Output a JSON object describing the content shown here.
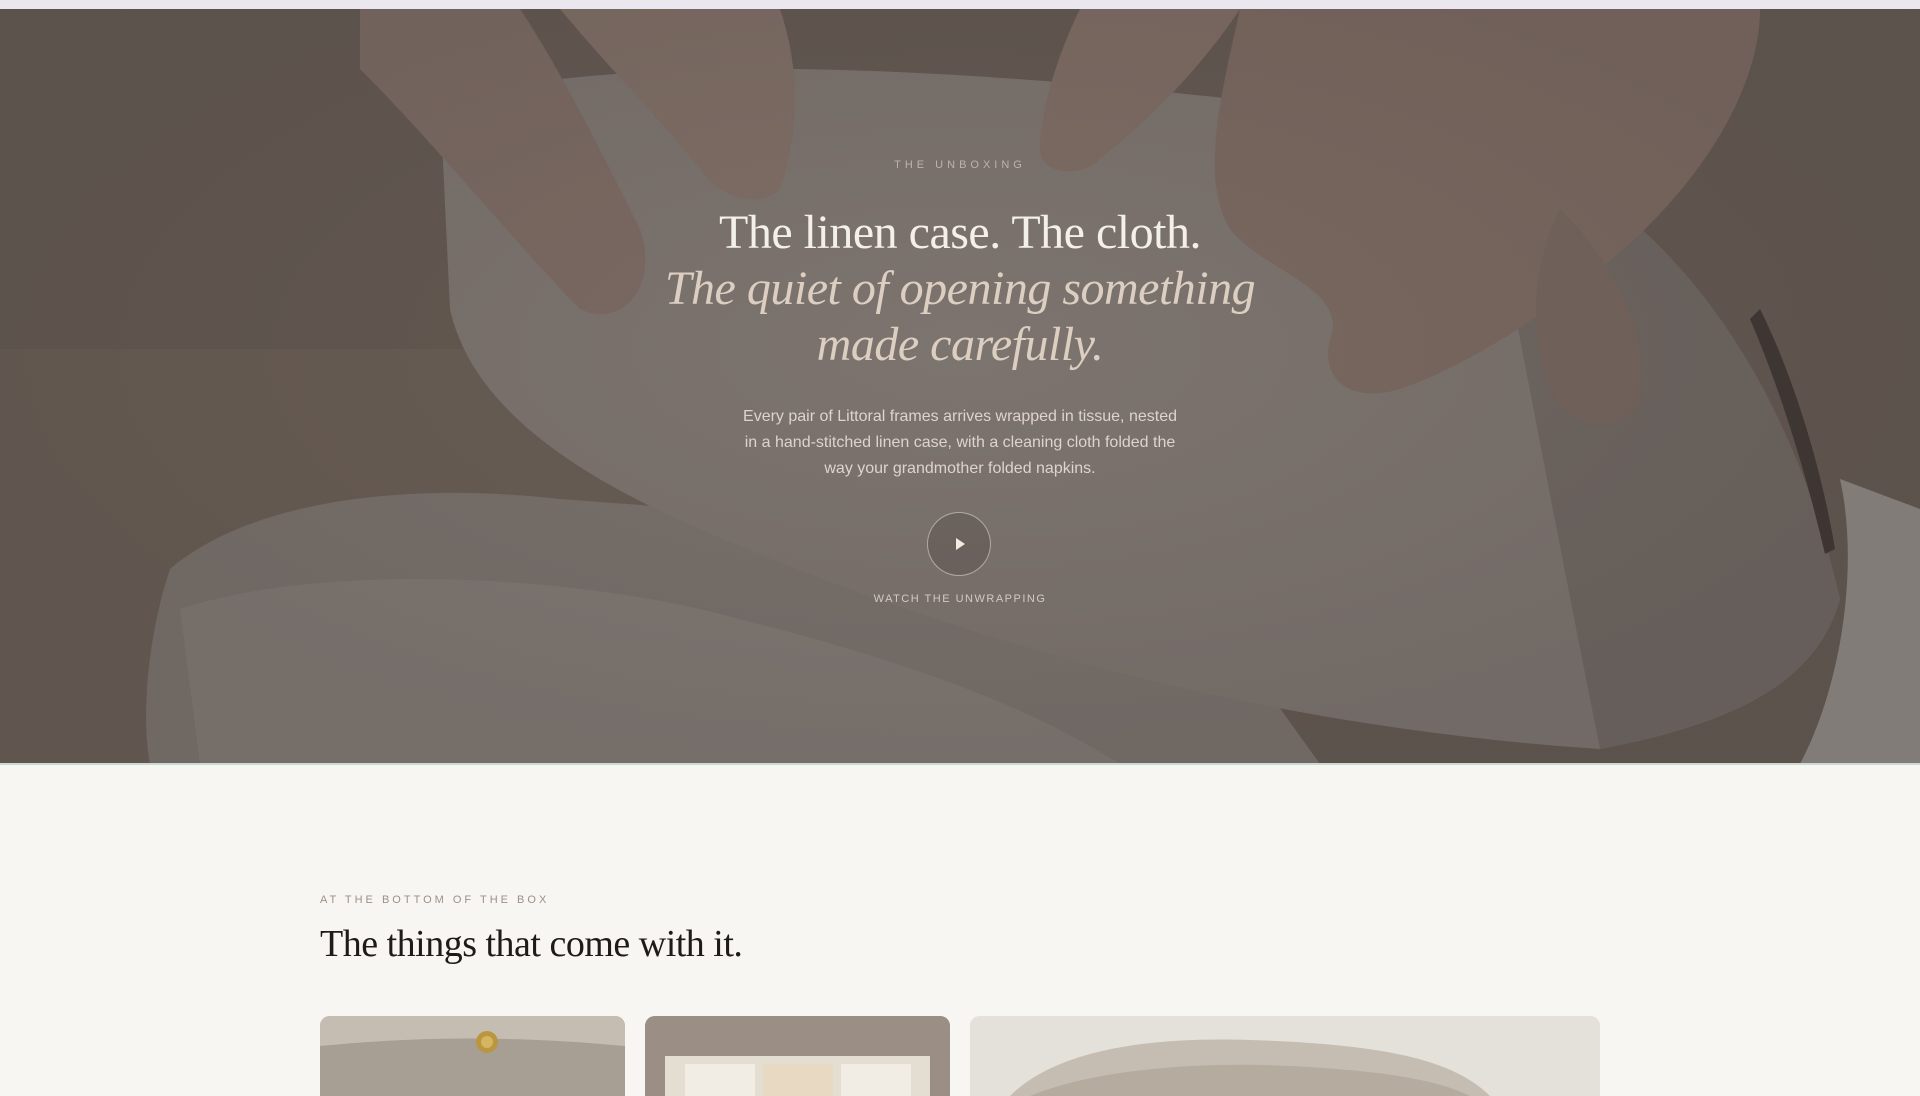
{
  "hero": {
    "eyebrow": "THE UNBOXING",
    "title_line1": "The linen case. The cloth.",
    "title_italic_1": "The quiet of opening something",
    "title_italic_2": "made carefully.",
    "body": "Every pair of Littoral frames arrives wrapped in tissue, nested in a hand-stitched linen case, with a cleaning cloth folded the way your grandmother folded napkins.",
    "play_icon": "play-icon",
    "watch_label": "WATCH THE UNWRAPPING"
  },
  "section": {
    "eyebrow": "AT THE BOTTOM OF THE BOX",
    "title": "The things that come with it."
  },
  "colors": {
    "background": "#f8f6f3",
    "hero_overlay": "#5e5652",
    "title_light": "#f3efea",
    "title_italic": "#dccfc2",
    "section_title": "#1f1b18"
  }
}
